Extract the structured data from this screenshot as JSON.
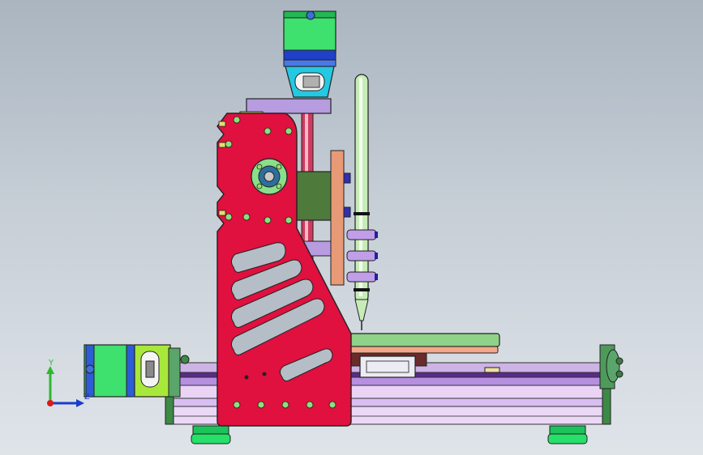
{
  "triad": {
    "y_label": "Y",
    "z_label": "Z",
    "colors": {
      "y": "#2eb82e",
      "z": "#1a3dcc",
      "x": "#d91a1a"
    }
  },
  "model": {
    "parts": [
      "spindle-motor",
      "motor-mount",
      "lead-screw",
      "z-carriage",
      "pen-holder",
      "pen",
      "gantry-side-plate",
      "work-table",
      "linear-slide",
      "base-extrusion",
      "y-axis-motor",
      "end-bracket",
      "feet"
    ],
    "colors": {
      "gantry": "#e0103f",
      "motor": "#34e064",
      "mount": "#24c8e0",
      "plate": "#b79ce0",
      "extrusion": "#e4c8f0",
      "table": "#9bd08a",
      "pen": "#c8ecb8",
      "carriage": "#4e7a3c"
    }
  }
}
